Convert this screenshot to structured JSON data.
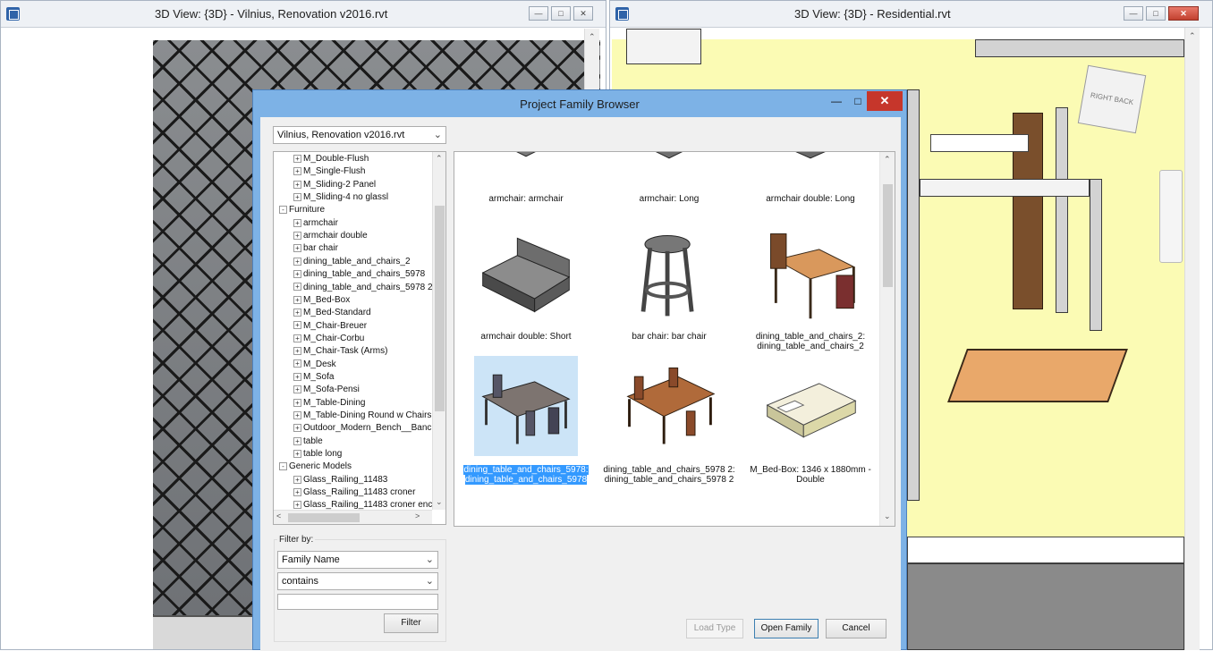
{
  "left_window": {
    "title": "3D View: {3D} - Vilnius, Renovation v2016.rvt"
  },
  "right_window": {
    "title": "3D View: {3D} - Residential.rvt",
    "viewcube": {
      "right": "RIGHT",
      "back": "BACK"
    }
  },
  "dialog": {
    "title": "Project Family Browser",
    "project_select": "Vilnius, Renovation v2016.rvt",
    "tree": [
      {
        "label": "M_Double-Flush",
        "level": 1,
        "toggle": "+"
      },
      {
        "label": "M_Single-Flush",
        "level": 1,
        "toggle": "+"
      },
      {
        "label": "M_Sliding-2 Panel",
        "level": 1,
        "toggle": "+"
      },
      {
        "label": "M_Sliding-4 no glassl",
        "level": 1,
        "toggle": "+"
      },
      {
        "label": "Furniture",
        "level": 0,
        "toggle": "-"
      },
      {
        "label": "armchair",
        "level": 1,
        "toggle": "+"
      },
      {
        "label": "armchair double",
        "level": 1,
        "toggle": "+"
      },
      {
        "label": "bar chair",
        "level": 1,
        "toggle": "+"
      },
      {
        "label": "dining_table_and_chairs_2",
        "level": 1,
        "toggle": "+"
      },
      {
        "label": "dining_table_and_chairs_5978",
        "level": 1,
        "toggle": "+"
      },
      {
        "label": "dining_table_and_chairs_5978 2",
        "level": 1,
        "toggle": "+"
      },
      {
        "label": "M_Bed-Box",
        "level": 1,
        "toggle": "+"
      },
      {
        "label": "M_Bed-Standard",
        "level": 1,
        "toggle": "+"
      },
      {
        "label": "M_Chair-Breuer",
        "level": 1,
        "toggle": "+"
      },
      {
        "label": "M_Chair-Corbu",
        "level": 1,
        "toggle": "+"
      },
      {
        "label": "M_Chair-Task (Arms)",
        "level": 1,
        "toggle": "+"
      },
      {
        "label": "M_Desk",
        "level": 1,
        "toggle": "+"
      },
      {
        "label": "M_Sofa",
        "level": 1,
        "toggle": "+"
      },
      {
        "label": "M_Sofa-Pensi",
        "level": 1,
        "toggle": "+"
      },
      {
        "label": "M_Table-Dining",
        "level": 1,
        "toggle": "+"
      },
      {
        "label": "M_Table-Dining Round w Chairs",
        "level": 1,
        "toggle": "+"
      },
      {
        "label": "Outdoor_Modern_Bench__Banc",
        "level": 1,
        "toggle": "+"
      },
      {
        "label": "table",
        "level": 1,
        "toggle": "+"
      },
      {
        "label": "table long",
        "level": 1,
        "toggle": "+"
      },
      {
        "label": "Generic Models",
        "level": 0,
        "toggle": "-"
      },
      {
        "label": "Glass_Railing_11483",
        "level": 1,
        "toggle": "+"
      },
      {
        "label": "Glass_Railing_11483 croner",
        "level": 1,
        "toggle": "+"
      },
      {
        "label": "Glass_Railing_11483 croner enc",
        "level": 1,
        "toggle": "+"
      }
    ],
    "thumbnails": [
      {
        "caption1": "armchair: armchair",
        "caption2": "",
        "icon": "armchair-thumbnail"
      },
      {
        "caption1": "armchair: Long",
        "caption2": "",
        "icon": "armchair-long-thumbnail"
      },
      {
        "caption1": "armchair double: Long",
        "caption2": "",
        "icon": "armchair-double-long-thumbnail"
      },
      {
        "caption1": "armchair double: Short",
        "caption2": "",
        "icon": "sofa-thumbnail"
      },
      {
        "caption1": "bar chair: bar chair",
        "caption2": "",
        "icon": "bar-stool-thumbnail"
      },
      {
        "caption1": "dining_table_and_chairs_2:",
        "caption2": "dining_table_and_chairs_2",
        "icon": "dining-set-thumbnail"
      },
      {
        "caption1": "dining_table_and_chairs_5978:",
        "caption2": "dining_table_and_chairs_5978",
        "icon": "dining-table-thumbnail",
        "selected": true
      },
      {
        "caption1": "dining_table_and_chairs_5978 2:",
        "caption2": "dining_table_and_chairs_5978 2",
        "icon": "dining-table-wood-thumbnail"
      },
      {
        "caption1": "M_Bed-Box: 1346 x 1880mm -",
        "caption2": "Double",
        "icon": "bed-thumbnail"
      }
    ],
    "filter": {
      "label": "Filter by:",
      "field": "Family Name",
      "operator": "contains",
      "value": "",
      "button": "Filter"
    },
    "buttons": {
      "load_type": "Load Type",
      "open_family": "Open Family",
      "cancel": "Cancel"
    }
  }
}
